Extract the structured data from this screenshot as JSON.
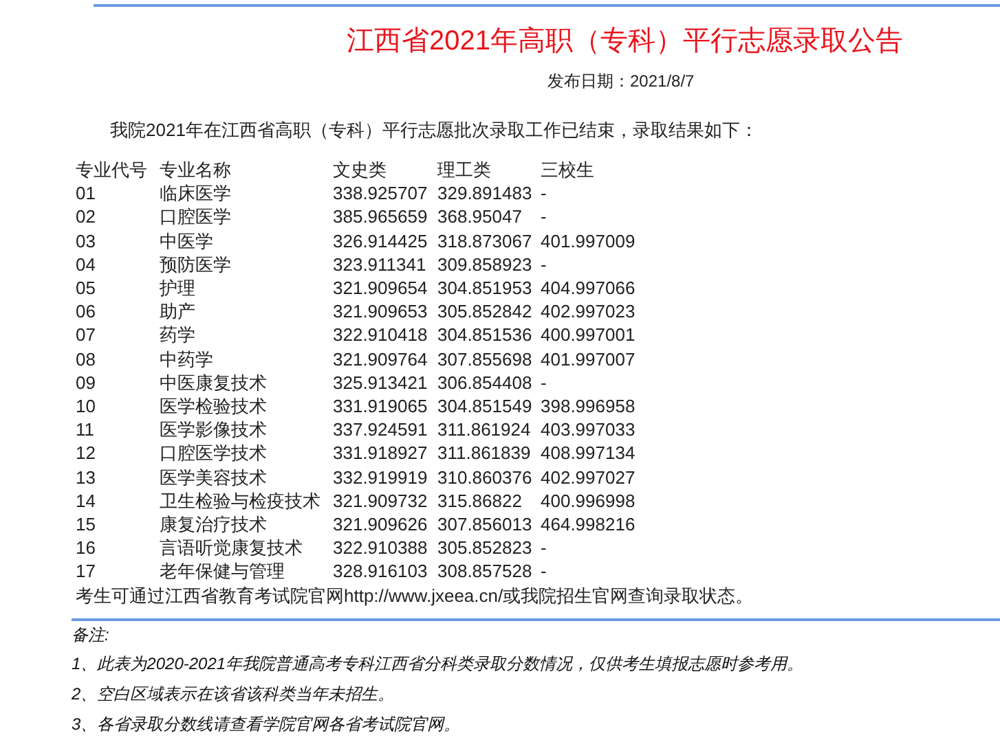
{
  "title": "江西省2021年高职（专科）平行志愿录取公告",
  "publish_date": "发布日期：2021/8/7",
  "intro": "我院2021年在江西省高职（专科）平行志愿批次录取工作已结束，录取结果如下：",
  "table": {
    "columns": [
      "专业代号",
      "专业名称",
      "文史类",
      "理工类",
      "三校生"
    ],
    "rows": [
      [
        "01",
        "临床医学",
        "338.925707",
        "329.891483",
        "-"
      ],
      [
        "02",
        "口腔医学",
        "385.965659",
        "368.95047",
        "-"
      ],
      [
        "03",
        "中医学",
        "326.914425",
        "318.873067",
        "401.997009"
      ],
      [
        "04",
        "预防医学",
        "323.911341",
        "309.858923",
        "-"
      ],
      [
        "05",
        "护理",
        "321.909654",
        "304.851953",
        "404.997066"
      ],
      [
        "06",
        "助产",
        "321.909653",
        "305.852842",
        "402.997023"
      ],
      [
        "07",
        "药学",
        "322.910418",
        "304.851536",
        "400.997001"
      ],
      [
        "08",
        "中药学",
        "321.909764",
        "307.855698",
        "401.997007"
      ],
      [
        "09",
        "中医康复技术",
        "325.913421",
        "306.854408",
        "-"
      ],
      [
        "10",
        "医学检验技术",
        "331.919065",
        "304.851549",
        "398.996958"
      ],
      [
        "11",
        "医学影像技术",
        "337.924591",
        "311.861924",
        "403.997033"
      ],
      [
        "12",
        "口腔医学技术",
        "331.918927",
        "311.861839",
        "408.997134"
      ],
      [
        "13",
        "医学美容技术",
        "332.919919",
        "310.860376",
        "402.997027"
      ],
      [
        "14",
        "卫生检验与检疫技术",
        "321.909732",
        "315.86822",
        "400.996998"
      ],
      [
        "15",
        "康复治疗技术",
        "321.909626",
        "307.856013",
        "464.998216"
      ],
      [
        "16",
        "言语听觉康复技术",
        "322.910388",
        "305.852823",
        "-"
      ],
      [
        "17",
        "老年保健与管理",
        "328.916103",
        "308.857528",
        "-"
      ]
    ]
  },
  "footer": "考生可通过江西省教育考试院官网http://www.jxeea.cn/或我院招生官网查询录取状态。",
  "notes": {
    "heading": "备注:",
    "items": [
      "1、此表为2020-2021年我院普通高考专科江西省分科类录取分数情况，仅供考生填报志愿时参考用。",
      "2、空白区域表示在该省该科类当年未招生。",
      "3、各省录取分数线请查看学院官网各省考试院官网。"
    ]
  }
}
